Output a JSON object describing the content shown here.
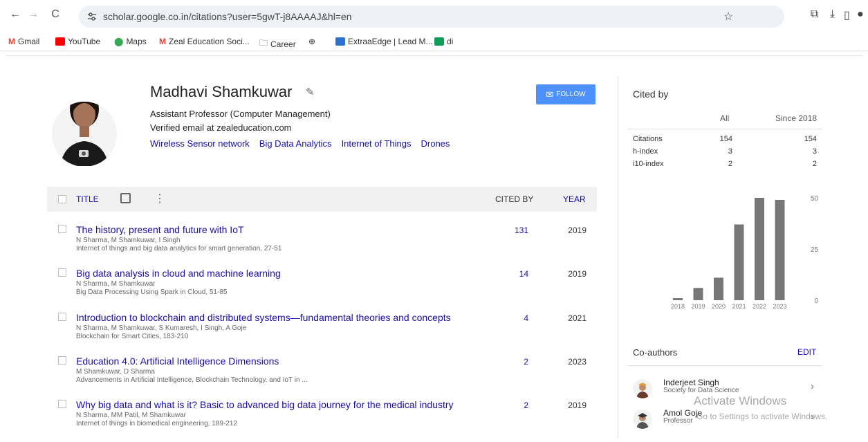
{
  "browser": {
    "url": "scholar.google.co.in/citations?user=5gwT-j8AAAAJ&hl=en",
    "bookmarks": [
      {
        "label": "Gmail",
        "icon": "gmail-icon",
        "color": "#ea4335"
      },
      {
        "label": "YouTube",
        "icon": "youtube-icon",
        "color": "#ff0000"
      },
      {
        "label": "Maps",
        "icon": "maps-icon",
        "color": "#34a853"
      },
      {
        "label": "Zeal Education Soci...",
        "icon": "gmail-icon",
        "color": "#ea4335"
      },
      {
        "label": "Career",
        "icon": "folder-icon",
        "color": "#555555"
      },
      {
        "label": "",
        "icon": "globe-icon",
        "color": "#444444"
      },
      {
        "label": "ExtraaEdge | Lead M...",
        "icon": "extraaedge-icon",
        "color": "#2f6fd1"
      },
      {
        "label": "di",
        "icon": "sheets-icon",
        "color": "#0f9d58"
      }
    ]
  },
  "profile": {
    "name": "Madhavi Shamkuwar",
    "affiliation": "Assistant Professor (Computer Management)",
    "email": "Verified email at zealeducation.com",
    "interests": [
      "Wireless Sensor network",
      "Big Data Analytics",
      "Internet of Things",
      "Drones"
    ],
    "follow_label": "FOLLOW"
  },
  "table": {
    "title_header": "TITLE",
    "cited_header": "CITED BY",
    "year_header": "YEAR",
    "rows": [
      {
        "title": "The history, present and future with IoT",
        "authors": "N Sharma, M Shamkuwar, I Singh",
        "pub": "Internet of things and big data analytics for smart generation, 27-51",
        "cited": "131",
        "year": "2019"
      },
      {
        "title": "Big data analysis in cloud and machine learning",
        "authors": "N Sharma, M Shamkuwar",
        "pub": "Big Data Processing Using Spark in Cloud, 51-85",
        "cited": "14",
        "year": "2019"
      },
      {
        "title": "Introduction to blockchain and distributed systems—fundamental theories and concepts",
        "authors": "N Sharma, M Shamkuwar, S Kumaresh, I Singh, A Goje",
        "pub": "Blockchain for Smart Cities, 183-210",
        "cited": "4",
        "year": "2021"
      },
      {
        "title": "Education 4.0: Artificial Intelligence Dimensions",
        "authors": "M Shamkuwar, D Sharma",
        "pub": "Advancements in Artificial Intelligence, Blockchain Technology, and IoT in ...",
        "cited": "2",
        "year": "2023"
      },
      {
        "title": "Why big data and what is it? Basic to advanced big data journey for the medical industry",
        "authors": "N Sharma, MM Patil, M Shamkuwar",
        "pub": "Internet of things in biomedical engineering, 189-212",
        "cited": "2",
        "year": "2019"
      }
    ]
  },
  "cited_by": {
    "title": "Cited by",
    "col_all": "All",
    "col_since": "Since 2018",
    "rows": [
      {
        "label": "Citations",
        "all": "154",
        "since": "154"
      },
      {
        "label": "h-index",
        "all": "3",
        "since": "3"
      },
      {
        "label": "i10-index",
        "all": "2",
        "since": "2"
      }
    ]
  },
  "chart_data": {
    "type": "bar",
    "categories": [
      "2018",
      "2019",
      "2020",
      "2021",
      "2022",
      "2023"
    ],
    "values": [
      1,
      6,
      11,
      37,
      50,
      49
    ],
    "ylim": [
      0,
      50
    ],
    "yticks": [
      "50",
      "25",
      "0"
    ],
    "bar_color": "#777777"
  },
  "coauthors": {
    "title": "Co-authors",
    "edit_label": "EDIT",
    "items": [
      {
        "name": "Inderjeet Singh",
        "affiliation": "Society for Data Science"
      },
      {
        "name": "Amol Goje",
        "affiliation": "Professor"
      }
    ]
  },
  "watermark": {
    "line1": "Activate Windows",
    "line2": "Go to Settings to activate Windows."
  }
}
